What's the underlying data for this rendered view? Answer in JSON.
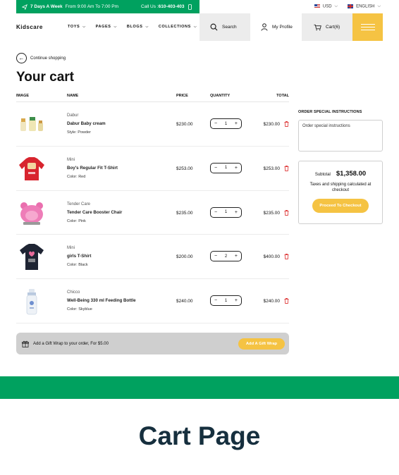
{
  "topbar": {
    "days_bold": "7 Days A Week",
    "hours": "From 9:00 Am To 7:00 Pm",
    "call_label": "Call Us :",
    "phone": "610-403-403",
    "currency": "USD",
    "language": "ENGLISH"
  },
  "header": {
    "logo": "Kidscare",
    "nav": [
      "TOYS",
      "PAGES",
      "BLOGS",
      "COLLECTIONS"
    ],
    "search_label": "Search",
    "profile_label": "My Profile",
    "cart_label": "Cart(6)"
  },
  "cart": {
    "continue_label": "Continue shopping",
    "title": "Your cart",
    "columns": {
      "image": "IMAGE",
      "name": "NAME",
      "price": "PRICE",
      "quantity": "QUANTITY",
      "total": "TOTAL"
    },
    "items": [
      {
        "brand": "Dabur",
        "name": "Dabur Baby cream",
        "variant_label": "Style:",
        "variant": "Powder",
        "price": "$230.00",
        "qty": "1",
        "total": "$230.00"
      },
      {
        "brand": "Mini",
        "name": "Boy's Regular Fit T-Shirt",
        "variant_label": "Color:",
        "variant": "Red",
        "price": "$253.00",
        "qty": "1",
        "total": "$253.00"
      },
      {
        "brand": "Tender Care",
        "name": "Tender Care Booster Chair",
        "variant_label": "Color:",
        "variant": "Pink",
        "price": "$235.00",
        "qty": "1",
        "total": "$235.00"
      },
      {
        "brand": "Mini",
        "name": "girls T-Shirt",
        "variant_label": "Color:",
        "variant": "Black",
        "price": "$200.00",
        "qty": "2",
        "total": "$400.00"
      },
      {
        "brand": "Chicco",
        "name": "Well-Being 330 ml Feeding Bottle",
        "variant_label": "Color:",
        "variant": "Skyblue",
        "price": "$240.00",
        "qty": "1",
        "total": "$240.00"
      }
    ],
    "gift_text": "Add a Gift Wrap to your order, For $5.00",
    "gift_button": "Add A Gift Wrap"
  },
  "sidebar": {
    "instructions_title": "ORDER SPECIAL INSTRUCTIONS",
    "instructions_placeholder": "Order special instructions",
    "subtotal_label": "Subtotal",
    "subtotal_value": "$1,358.00",
    "taxes_note": "Taxes and shipping calculated at checkout",
    "checkout_button": "Proceed To Checkout"
  },
  "caption": "Cart Page",
  "colors": {
    "green": "#00a15f",
    "yellow": "#f5c343",
    "caption": "#162f3e",
    "trash": "#e04444"
  },
  "icons": [
    "send-icon",
    "phone-icon",
    "search-icon",
    "user-icon",
    "cart-icon",
    "menu-icon",
    "arrow-left-icon",
    "minus-icon",
    "plus-icon",
    "trash-icon",
    "gift-icon"
  ]
}
